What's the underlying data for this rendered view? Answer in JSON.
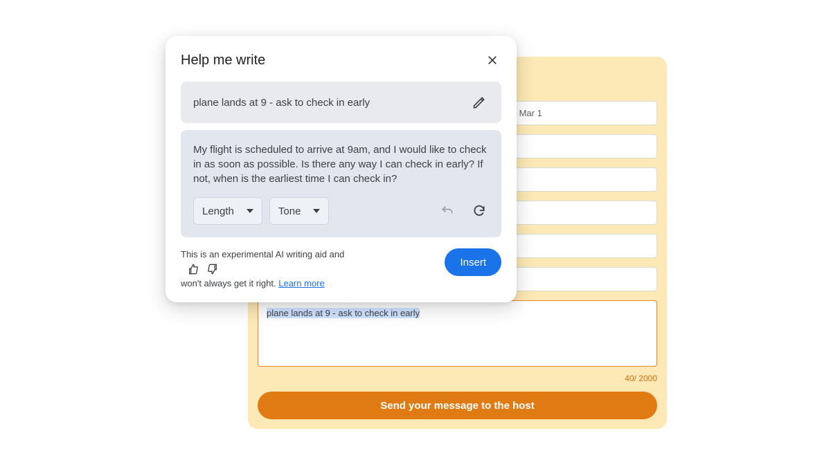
{
  "popup": {
    "title": "Help me write",
    "prompt": "plane lands at 9 - ask to check in early",
    "result": "My flight is scheduled to arrive at 9am, and I would like to check in as soon as possible. Is there any way I can check in early? If not, when is the earliest time I can check in?",
    "length_label": "Length",
    "tone_label": "Tone",
    "disclaimer_a": "This is an experimental AI writing aid and",
    "disclaimer_b": "won't always get it right.",
    "learn_more": "Learn more",
    "insert": "Insert"
  },
  "form": {
    "checkout_field": "Check out - Mar 1",
    "textarea_value": "plane lands at 9 - ask to check in early",
    "char_count": "40/ 2000",
    "send_label": "Send your message to the host"
  }
}
